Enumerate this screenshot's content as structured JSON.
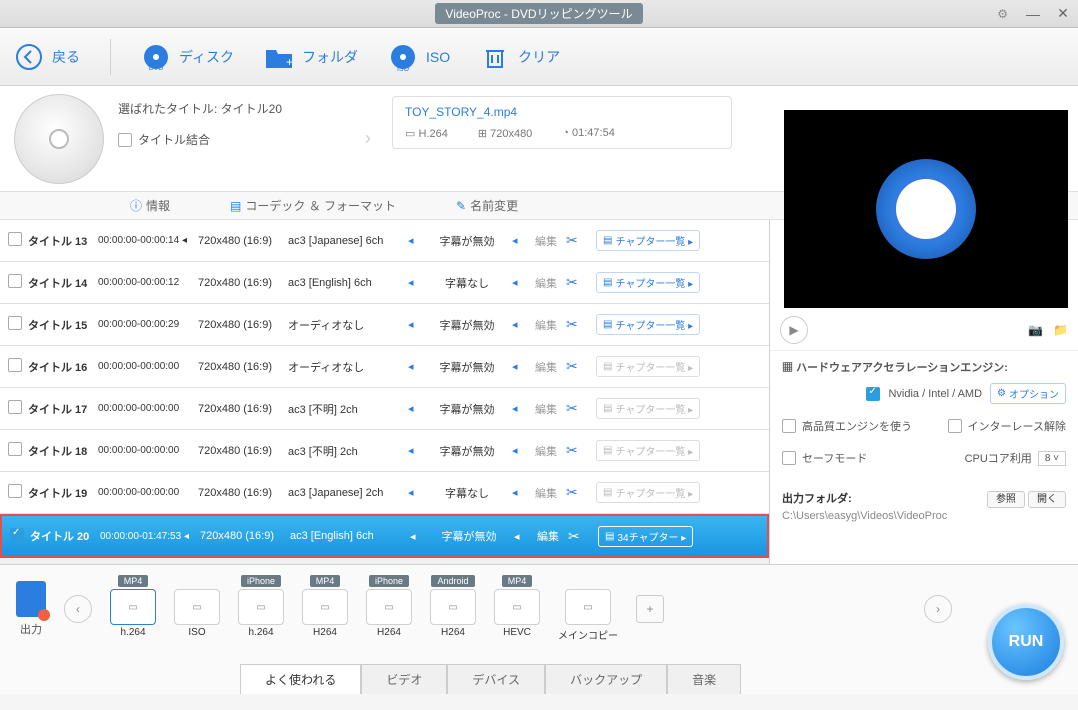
{
  "titlebar": {
    "title": "VideoProc - DVDリッピングツール"
  },
  "toolbar": {
    "back": "戻る",
    "disc": "ディスク",
    "folder": "フォルダ",
    "iso": "ISO",
    "clear": "クリア"
  },
  "selected": {
    "label": "選ばれたタイトル: タイトル20",
    "merge_label": "タイトル結合"
  },
  "output": {
    "filename": "TOY_STORY_4.mp4",
    "codec": "H.264",
    "resolution": "720x480",
    "duration": "01:47:54"
  },
  "subbar": {
    "info": "情報",
    "codec": "コーデック ＆ フォーマット",
    "rename": "名前変更"
  },
  "col_labels": {
    "edit": "編集",
    "chapters": "チャプター一覧"
  },
  "titles": [
    {
      "id": "タイトル 13",
      "time": "00:00:00-00:00:14",
      "res": "720x480 (16:9)",
      "audio": "ac3 [Japanese] 6ch",
      "sub": "字幕が無効",
      "dim": false,
      "sel": false,
      "arrow": true
    },
    {
      "id": "タイトル 14",
      "time": "00:00:00-00:00:12",
      "res": "720x480 (16:9)",
      "audio": "ac3 [English] 6ch",
      "sub": "字幕なし",
      "dim": false,
      "sel": false,
      "arrow": false
    },
    {
      "id": "タイトル 15",
      "time": "00:00:00-00:00:29",
      "res": "720x480 (16:9)",
      "audio": "オーディオなし",
      "sub": "字幕が無効",
      "dim": false,
      "sel": false,
      "arrow": false
    },
    {
      "id": "タイトル 16",
      "time": "00:00:00-00:00:00",
      "res": "720x480 (16:9)",
      "audio": "オーディオなし",
      "sub": "字幕が無効",
      "dim": true,
      "sel": false,
      "arrow": false
    },
    {
      "id": "タイトル 17",
      "time": "00:00:00-00:00:00",
      "res": "720x480 (16:9)",
      "audio": "ac3 [不明] 2ch",
      "sub": "字幕が無効",
      "dim": true,
      "sel": false,
      "arrow": false
    },
    {
      "id": "タイトル 18",
      "time": "00:00:00-00:00:00",
      "res": "720x480 (16:9)",
      "audio": "ac3 [不明] 2ch",
      "sub": "字幕が無効",
      "dim": true,
      "sel": false,
      "arrow": false
    },
    {
      "id": "タイトル 19",
      "time": "00:00:00-00:00:00",
      "res": "720x480 (16:9)",
      "audio": "ac3 [Japanese] 2ch",
      "sub": "字幕なし",
      "dim": true,
      "sel": false,
      "arrow": false
    },
    {
      "id": "タイトル 20",
      "time": "00:00:00-01:47:53",
      "res": "720x480 (16:9)",
      "audio": "ac3 [English] 6ch",
      "sub": "字幕が無効",
      "dim": false,
      "sel": true,
      "chapters_label": "34チャプター",
      "arrow": true
    }
  ],
  "hw": {
    "title": "ハードウェアアクセラレーションエンジン:",
    "vendors": "Nvidia / Intel / AMD",
    "option_btn": "オプション",
    "hq_engine": "高品質エンジンを使う",
    "deinterlace": "インターレース解除",
    "safe_mode": "セーフモード",
    "cpu_label": "CPUコア利用",
    "cpu_value": "8"
  },
  "output_folder": {
    "label": "出力フォルダ:",
    "browse": "参照",
    "open": "開く",
    "path": "C:\\Users\\easyg\\Videos\\VideoProc"
  },
  "presets_label": "出力",
  "presets": [
    {
      "badge": "MP4",
      "label": "h.264",
      "sel": true
    },
    {
      "badge": "",
      "label": "ISO",
      "sel": false
    },
    {
      "badge": "iPhone",
      "label": "h.264",
      "sel": false
    },
    {
      "badge": "MP4",
      "label": "H264",
      "sel": false
    },
    {
      "badge": "iPhone",
      "label": "H264",
      "sel": false
    },
    {
      "badge": "Android",
      "label": "H264",
      "sel": false
    },
    {
      "badge": "MP4",
      "label": "HEVC",
      "sel": false
    },
    {
      "badge": "",
      "label": "メインコピー",
      "sel": false
    }
  ],
  "tabs": [
    {
      "label": "よく使われる",
      "active": true
    },
    {
      "label": "ビデオ",
      "active": false
    },
    {
      "label": "デバイス",
      "active": false
    },
    {
      "label": "バックアップ",
      "active": false
    },
    {
      "label": "音楽",
      "active": false
    }
  ],
  "run": "RUN"
}
